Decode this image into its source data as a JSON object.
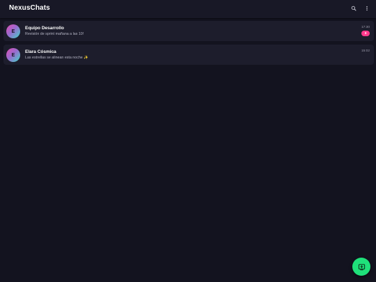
{
  "header": {
    "title": "NexusChats",
    "search_icon": "search-icon",
    "more_icon": "more-vert-icon"
  },
  "chats": [
    {
      "avatar_letter": "E",
      "name": "Equipo Desarrollo",
      "preview": "Revisión de sprint mañana a las 10!",
      "time": "17:30",
      "unread": "3"
    },
    {
      "avatar_letter": "E",
      "name": "Elara Cósmica",
      "preview": "Las estrellas se alinean esta noche ✨",
      "time": "15:02"
    }
  ],
  "fab": {
    "icon": "new-chat-icon"
  },
  "colors": {
    "background": "#13131f",
    "header": "#181826",
    "card": "#1d1d2c",
    "badge": "#ff3a8c",
    "fab": "#1fe07a"
  }
}
